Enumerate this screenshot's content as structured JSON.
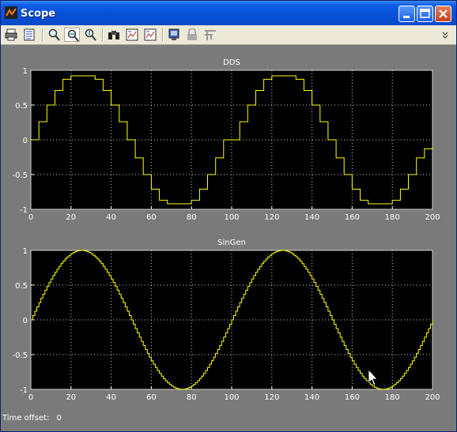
{
  "window": {
    "title": "Scope"
  },
  "toolbar": {
    "items": [
      {
        "name": "print-icon"
      },
      {
        "name": "parameters-icon"
      },
      {
        "name": "zoom-icon"
      },
      {
        "name": "zoom-x-icon"
      },
      {
        "name": "zoom-y-icon"
      },
      {
        "name": "autoscale-binoculars-icon"
      },
      {
        "name": "save-axes-settings-icon"
      },
      {
        "name": "restore-axes-settings-icon"
      },
      {
        "name": "floating-scope-icon"
      },
      {
        "name": "lock-axes-icon"
      },
      {
        "name": "signal-selection-icon"
      }
    ]
  },
  "status": {
    "label": "Time offset:",
    "value": "0"
  },
  "colors": {
    "trace": "#ffff00",
    "axes_bg": "#000000",
    "figure_bg": "#7a7a7a",
    "grid": "#ffffff",
    "text": "#ffffff"
  },
  "chart_data": [
    {
      "type": "line",
      "title": "DDS",
      "xlim": [
        0,
        200
      ],
      "ylim": [
        -1,
        1
      ],
      "xticks": [
        "0",
        "20",
        "40",
        "60",
        "80",
        "100",
        "120",
        "140",
        "160",
        "180",
        "200"
      ],
      "yticks": [
        "1",
        "0.5",
        "0",
        "-0.5",
        "-1"
      ],
      "grid": true,
      "series": [
        {
          "style": "staircase",
          "x": [
            0,
            4,
            8,
            12,
            16,
            20,
            24,
            28,
            32,
            36,
            40,
            44,
            48,
            52,
            56,
            60,
            64,
            68,
            72,
            76,
            80,
            84,
            88,
            92,
            96,
            100,
            104,
            108,
            112,
            116,
            120,
            124,
            128,
            132,
            136,
            140,
            144,
            148,
            152,
            156,
            160,
            164,
            168,
            172,
            176,
            180,
            184,
            188,
            192,
            196,
            200
          ],
          "y": [
            0.0,
            0.26,
            0.5,
            0.71,
            0.87,
            0.92,
            0.92,
            0.92,
            0.87,
            0.71,
            0.5,
            0.26,
            0.0,
            -0.26,
            -0.5,
            -0.71,
            -0.87,
            -0.92,
            -0.92,
            -0.92,
            -0.87,
            -0.71,
            -0.5,
            -0.26,
            0.0,
            0.0,
            0.26,
            0.5,
            0.71,
            0.87,
            0.92,
            0.92,
            0.92,
            0.87,
            0.71,
            0.5,
            0.26,
            0.0,
            -0.26,
            -0.5,
            -0.71,
            -0.87,
            -0.92,
            -0.92,
            -0.92,
            -0.87,
            -0.71,
            -0.5,
            -0.26,
            -0.13,
            -0.1
          ]
        }
      ]
    },
    {
      "type": "line",
      "title": "SinGen",
      "xlim": [
        0,
        200
      ],
      "ylim": [
        -1,
        1
      ],
      "xticks": [
        "0",
        "20",
        "40",
        "60",
        "80",
        "100",
        "120",
        "140",
        "160",
        "180",
        "200"
      ],
      "yticks": [
        "1",
        "0.5",
        "0",
        "-0.5",
        "-1"
      ],
      "grid": true,
      "series": [
        {
          "style": "staircase",
          "period": 100,
          "amplitude": 1,
          "phase_start": 0,
          "x_start": 0,
          "x_end": 200
        }
      ]
    }
  ]
}
